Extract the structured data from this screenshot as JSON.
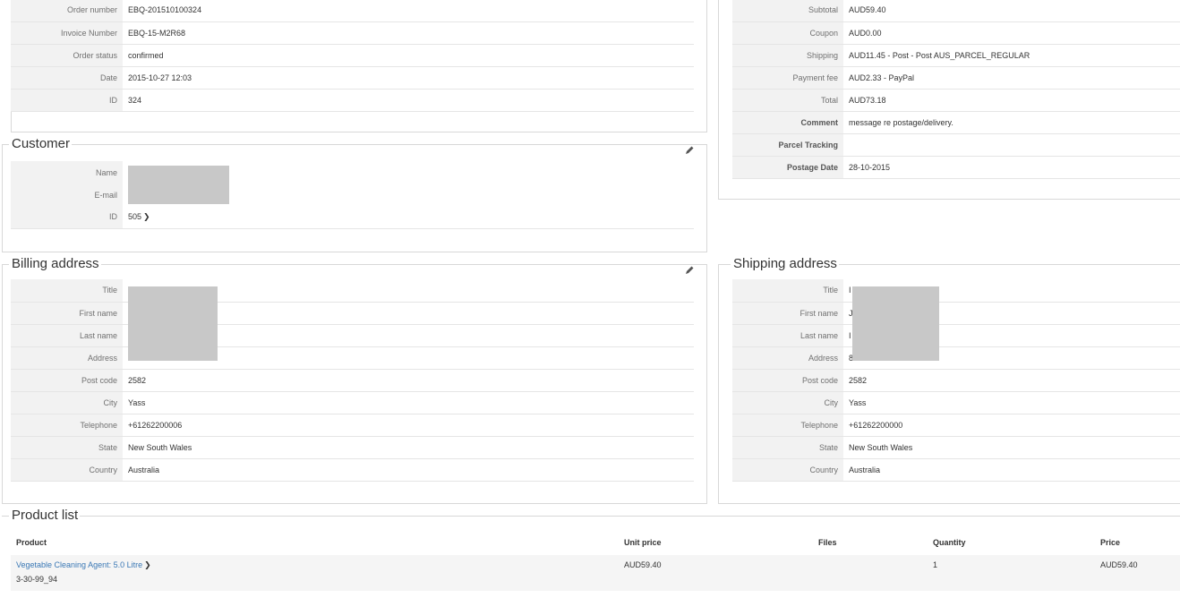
{
  "order": {
    "rows": [
      {
        "label": "Order number",
        "value": "EBQ-201510100324"
      },
      {
        "label": "Invoice Number",
        "value": "EBQ-15-M2R68"
      },
      {
        "label": "Order status",
        "value": "confirmed"
      },
      {
        "label": "Date",
        "value": "2015-10-27 12:03"
      },
      {
        "label": "ID",
        "value": "324"
      }
    ]
  },
  "totals": {
    "rows": [
      {
        "label": "Subtotal",
        "value": "AUD59.40"
      },
      {
        "label": "Coupon",
        "value": "AUD0.00"
      },
      {
        "label": "Shipping",
        "value": "AUD11.45 - Post - Post AUS_PARCEL_REGULAR"
      },
      {
        "label": "Payment fee",
        "value": "AUD2.33 - PayPal"
      },
      {
        "label": "Total",
        "value": "AUD73.18"
      },
      {
        "label": "Comment",
        "value": "message re postage/delivery."
      },
      {
        "label": "Parcel Tracking",
        "value": ""
      },
      {
        "label": "Postage Date",
        "value": "28-10-2015"
      }
    ]
  },
  "customer": {
    "legend": "Customer",
    "rows": [
      {
        "label": "Name",
        "value": ""
      },
      {
        "label": "E-mail",
        "value": ""
      },
      {
        "label": "ID",
        "value": "505"
      }
    ]
  },
  "billing": {
    "legend": "Billing address",
    "rows": [
      {
        "label": "Title",
        "value": ""
      },
      {
        "label": "First name",
        "value": ""
      },
      {
        "label": "Last name",
        "value": ""
      },
      {
        "label": "Address",
        "value": ""
      },
      {
        "label": "Post code",
        "value": "2582"
      },
      {
        "label": "City",
        "value": "Yass"
      },
      {
        "label": "Telephone",
        "value": "+61262200006"
      },
      {
        "label": "State",
        "value": "New South Wales"
      },
      {
        "label": "Country",
        "value": "Australia"
      }
    ]
  },
  "shipping": {
    "legend": "Shipping address",
    "rows": [
      {
        "label": "Title",
        "value": "I"
      },
      {
        "label": "First name",
        "value": "J"
      },
      {
        "label": "Last name",
        "value": "I"
      },
      {
        "label": "Address",
        "value": "8"
      },
      {
        "label": "Post code",
        "value": "2582"
      },
      {
        "label": "City",
        "value": "Yass"
      },
      {
        "label": "Telephone",
        "value": "+61262200000"
      },
      {
        "label": "State",
        "value": "New South Wales"
      },
      {
        "label": "Country",
        "value": "Australia"
      }
    ]
  },
  "products": {
    "legend": "Product list",
    "headers": {
      "product": "Product",
      "unit_price": "Unit price",
      "files": "Files",
      "quantity": "Quantity",
      "price": "Price"
    },
    "items": [
      {
        "name": "Vegetable Cleaning Agent: 5.0 Litre",
        "code": "3-30-99_94",
        "unit_price": "AUD59.40",
        "files": "",
        "quantity": "1",
        "price": "AUD59.40"
      }
    ]
  },
  "icons": {
    "edit": "pencil-icon",
    "go": "chevron-right-icon"
  },
  "colors": {
    "link": "#3a78b5",
    "label_bg": "#f2f2f2",
    "redaction": "#c8c8c8"
  }
}
